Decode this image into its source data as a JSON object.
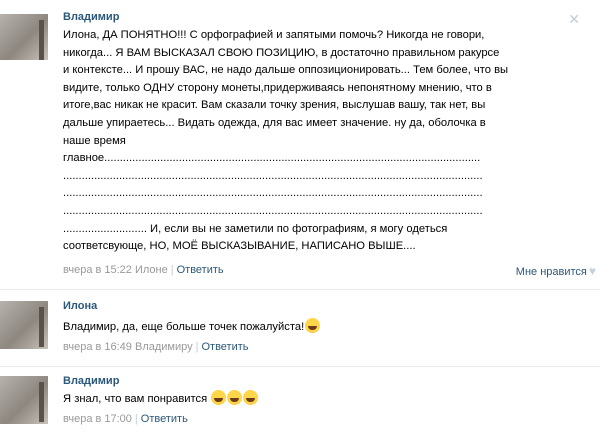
{
  "comments": [
    {
      "author": "Владимир",
      "lines": [
        "Илона, ДА ПОНЯТНО!!! С орфографией и запятыми помочь? Никогда не говори,",
        "никогда... Я ВАМ ВЫСКАЗАЛ СВОЮ ПОЗИЦИЮ, в достаточно правильном ракурсе",
        "и контексте... И прошу ВАС, не надо дальше оппозиционировать... Тем более, что вы",
        "видите, только ОДНУ сторону монеты,придерживаясь непонятному мнению, что в",
        "итоге,вас никак не красит. Вам сказали точку зрения, выслушав вашу, так нет, вы",
        "дальше упираетесь... Видать одежда, для вас имеет значение. ну да, оболочка в",
        "наше время",
        "главное.........................................................................................................................",
        ".......................................................................................................................................",
        ".......................................................................................................................................",
        ".......................................................................................................................................",
        "........................... И, если вы не заметили по фотографиям, я могу одеться",
        "соответсвующе, НО, МОЁ ВЫСКАЗЫВАНИЕ, НАПИСАНО ВЫШЕ...."
      ],
      "date": "вчера в 15:22",
      "reply_to": "Илоне",
      "reply_label": "Ответить",
      "like_label": "Мне нравится"
    },
    {
      "author": "Илона",
      "text": "Владимир, да, еще больше точек пожалуйста!",
      "date": "вчера в 16:49",
      "reply_to": "Владимиру",
      "reply_label": "Ответить"
    },
    {
      "author": "Владимир",
      "text": "Я знал, что вам понравится ",
      "date": "вчера в 17:00",
      "reply_label": "Ответить"
    }
  ],
  "icons": {
    "close": "close-icon",
    "heart": "heart-icon",
    "emoji": "laughing-emoji-icon"
  },
  "colors": {
    "link": "#2b587a",
    "meta": "#999999"
  }
}
